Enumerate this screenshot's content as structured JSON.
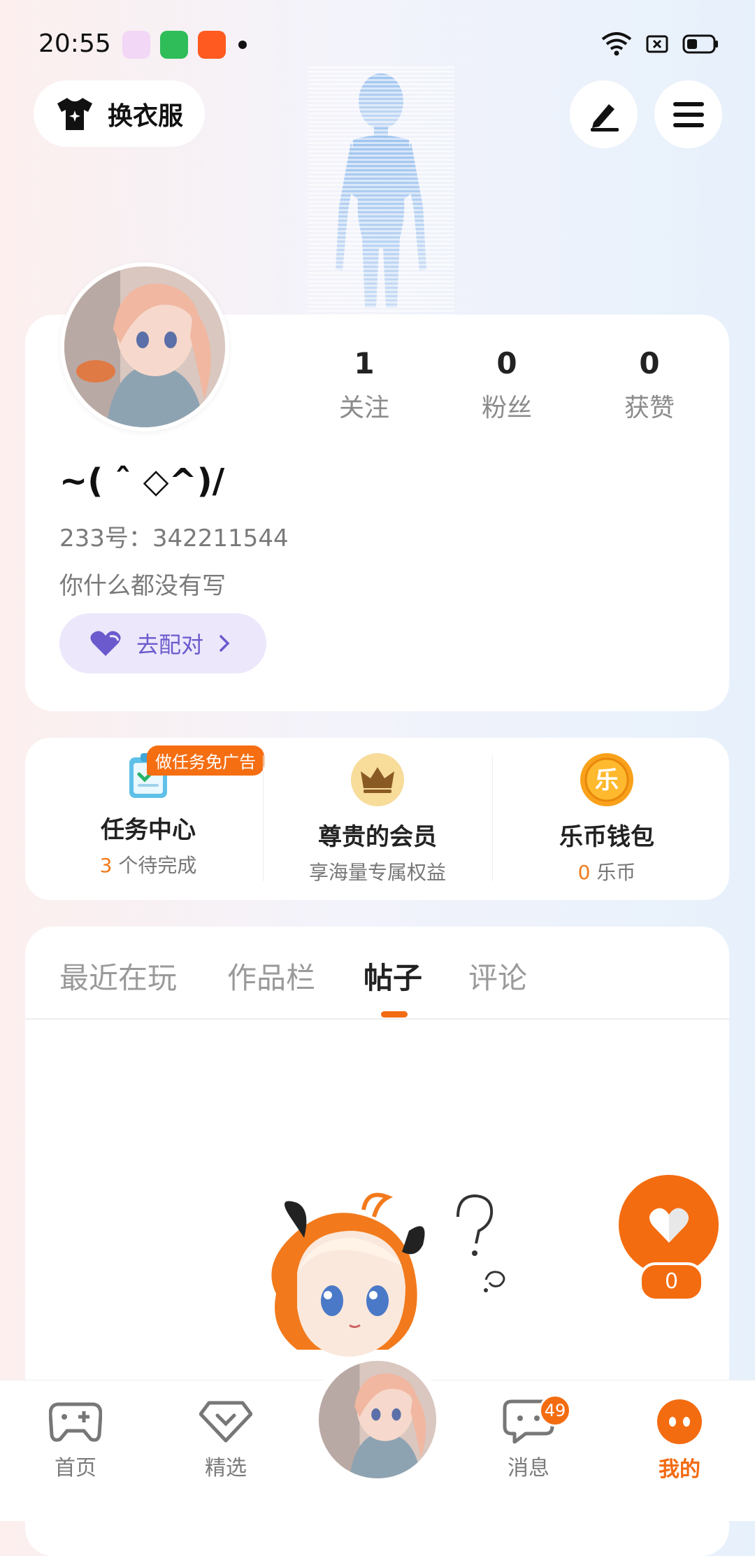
{
  "status_bar": {
    "time": "20:55",
    "app_icon_colors": [
      "#f3d7f6",
      "#2ebd59",
      "#ff5a1f"
    ]
  },
  "top_bar": {
    "wardrobe_label": "换衣服",
    "edit_icon": "edit-icon",
    "menu_icon": "menu-icon"
  },
  "profile": {
    "stats": [
      {
        "value": "1",
        "label": "关注"
      },
      {
        "value": "0",
        "label": "粉丝"
      },
      {
        "value": "0",
        "label": "获赞"
      }
    ],
    "nickname": "~( ˆ ◇^)/",
    "uid": "233号：342211544",
    "bio": "你什么都没有写",
    "match_label": "去配对"
  },
  "services": {
    "task_badge": "做任务免广告",
    "items": [
      {
        "title": "任务中心",
        "count": "3",
        "sub": " 个待完成"
      },
      {
        "title": "尊贵的会员",
        "sub": "享海量专属权益"
      },
      {
        "title": "乐币钱包",
        "count": "0",
        "sub": " 乐币",
        "coin_glyph": "乐"
      }
    ]
  },
  "tabs": [
    {
      "label": "最近在玩",
      "active": false
    },
    {
      "label": "作品栏",
      "active": false
    },
    {
      "label": "帖子",
      "active": true
    },
    {
      "label": "评论",
      "active": false
    }
  ],
  "like_fab": {
    "count": "0"
  },
  "bottom_nav": {
    "items": [
      {
        "label": "首页",
        "icon": "gamepad-icon"
      },
      {
        "label": "精选",
        "icon": "heart-gem-icon"
      },
      {
        "label": "消息",
        "icon": "chat-icon",
        "badge": "49"
      },
      {
        "label": "我的",
        "icon": "profile-face-icon",
        "active": true
      }
    ]
  },
  "colors": {
    "accent": "#f46c10",
    "match_bg": "#ece7fb",
    "match_text": "#6a5acd"
  }
}
